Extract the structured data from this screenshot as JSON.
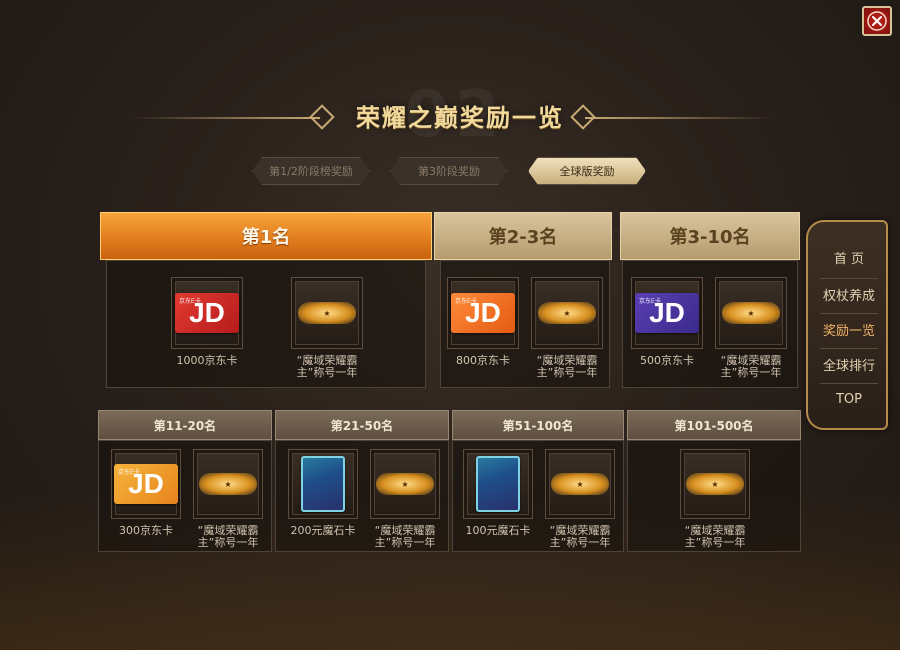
{
  "modal": {
    "title": "荣耀之巅奖励一览",
    "title_bg_number": "02",
    "close_icon": "close-icon"
  },
  "tabs": [
    {
      "label": "第1/2阶段榜奖励",
      "active": false
    },
    {
      "label": "第3阶段奖励",
      "active": false
    },
    {
      "label": "全球版奖励",
      "active": true
    }
  ],
  "top_ranks": [
    {
      "rank": "第1名",
      "items": [
        {
          "caption": "1000京东卡",
          "icon": "jd-card-red-icon",
          "card_text": "JD"
        },
        {
          "caption": "“魔域荣耀霸主”称号一年",
          "icon": "title-badge-icon"
        }
      ]
    },
    {
      "rank": "第2-3名",
      "items": [
        {
          "caption": "800京东卡",
          "icon": "jd-card-orange-icon",
          "card_text": "JD"
        },
        {
          "caption": "“魔域荣耀霸主”称号一年",
          "icon": "title-badge-icon"
        }
      ]
    },
    {
      "rank": "第3-10名",
      "items": [
        {
          "caption": "500京东卡",
          "icon": "jd-card-purple-icon",
          "card_text": "JD"
        },
        {
          "caption": "“魔域荣耀霸主”称号一年",
          "icon": "title-badge-icon"
        }
      ]
    }
  ],
  "bottom_ranks": [
    {
      "rank": "第11-20名",
      "items": [
        {
          "caption": "300京东卡",
          "icon": "jd-card-amber-icon",
          "card_text": "JD"
        },
        {
          "caption": "“魔域荣耀霸主”称号一年",
          "icon": "title-badge-icon"
        }
      ]
    },
    {
      "rank": "第21-50名",
      "items": [
        {
          "caption": "200元魔石卡",
          "icon": "magic-stone-card-stack-icon"
        },
        {
          "caption": "“魔域荣耀霸主”称号一年",
          "icon": "title-badge-icon"
        }
      ]
    },
    {
      "rank": "第51-100名",
      "items": [
        {
          "caption": "100元魔石卡",
          "icon": "magic-stone-card-icon"
        },
        {
          "caption": "“魔域荣耀霸主”称号一年",
          "icon": "title-badge-icon"
        }
      ]
    },
    {
      "rank": "第101-500名",
      "items": [
        {
          "caption": "“魔域荣耀霸主”称号一年",
          "icon": "title-badge-icon"
        }
      ]
    }
  ],
  "side_nav": [
    {
      "label": "首 页",
      "active": false
    },
    {
      "label": "权杖养成",
      "active": false
    },
    {
      "label": "奖励一览",
      "active": true
    },
    {
      "label": "全球排行",
      "active": false
    },
    {
      "label": "TOP",
      "active": false
    }
  ],
  "colors": {
    "accent_gold": "#f2d99c",
    "active_rank_orange": "#e07a1c",
    "nav_active": "#f3b56a"
  }
}
